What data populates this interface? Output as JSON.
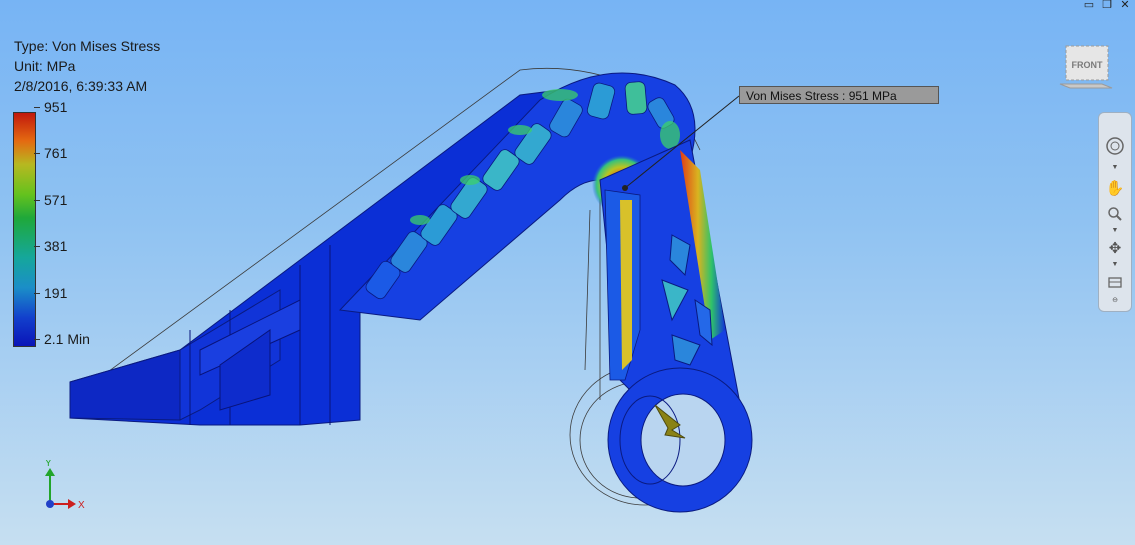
{
  "window": {
    "controls": [
      "minimize-icon",
      "restore-icon",
      "close-icon"
    ],
    "minimize_glyph": "▭",
    "restore_glyph": "❐",
    "close_glyph": "✕"
  },
  "legend": {
    "type_line": "Type: Von Mises Stress",
    "unit_line": "Unit: MPa",
    "timestamp": "2/8/2016, 6:39:33 AM",
    "ticks": [
      "951",
      "761",
      "571",
      "381",
      "191",
      "2.1 Min"
    ],
    "max_value": 951,
    "min_value": 2.1
  },
  "probe": {
    "label": "Von Mises Stress : 951 MPa"
  },
  "viewcube": {
    "face_label": "FRONT"
  },
  "navigation_bar": {
    "items": [
      "steering-wheel-icon",
      "pan-icon",
      "zoom-icon",
      "orbit-icon",
      "look-at-icon"
    ]
  },
  "triad": {
    "y_label": "Y",
    "x_label": "X",
    "y_color": "#22a52a",
    "x_color": "#cc1f1f"
  },
  "colors": {
    "max_stress": "#c1180c",
    "min_stress": "#0a14b8",
    "background_top": "#77b4f4",
    "background_bottom": "#c6dff1"
  }
}
